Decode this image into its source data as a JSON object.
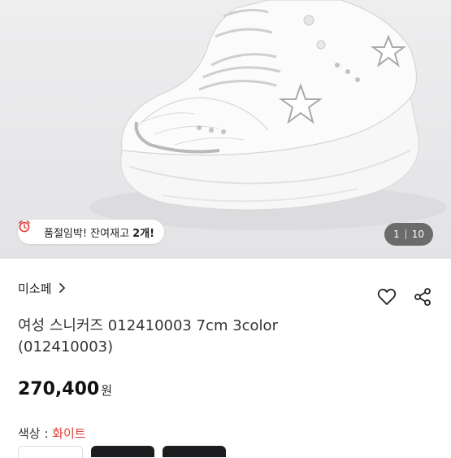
{
  "gallery": {
    "image_alt": "white sneaker product photo",
    "stock_notice": {
      "prefix": "품절임박! 잔여재고 ",
      "count": "2개!"
    },
    "counter": {
      "current": "1",
      "total": "10"
    }
  },
  "product": {
    "brand": "미소페",
    "title": "여성 스니커즈 012410003 7cm 3color (012410003)",
    "price": "270,400",
    "price_unit": "원",
    "color_label": "색상 : ",
    "color_value": "화이트"
  },
  "icons": {
    "alarm": "alarm-clock-icon",
    "chevron": "chevron-right-icon",
    "wishlist": "heart-icon",
    "share": "share-icon"
  },
  "colors": {
    "accent_red": "#e53935",
    "dark_button": "#1d1d1f"
  }
}
